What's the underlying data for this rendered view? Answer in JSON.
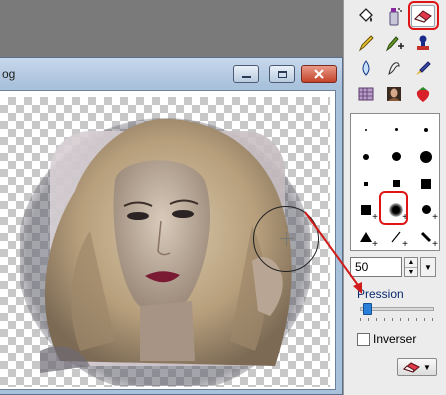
{
  "image_window": {
    "title": "og"
  },
  "tools": {
    "rows": [
      [
        "fill-bucket-icon",
        "spray-bottle-icon",
        "eraser-icon"
      ],
      [
        "pencil-icon",
        "brush-plus-icon",
        "stamp-icon"
      ],
      [
        "water-drop-icon",
        "smudge-icon",
        "paint-brush-icon"
      ],
      [
        "texture-icon",
        "portrait-icon",
        "strawberry-icon"
      ]
    ],
    "selected": "eraser-icon"
  },
  "brushes": {
    "selected_index": 10
  },
  "size": {
    "value": "50"
  },
  "pression": {
    "label": "Pression",
    "level": 0.05
  },
  "inverser": {
    "label": "Inverser",
    "checked": false
  },
  "colors": {
    "highlight": "#e01414",
    "arrow": "#d11a1a",
    "slider": "#2a7fd8"
  }
}
